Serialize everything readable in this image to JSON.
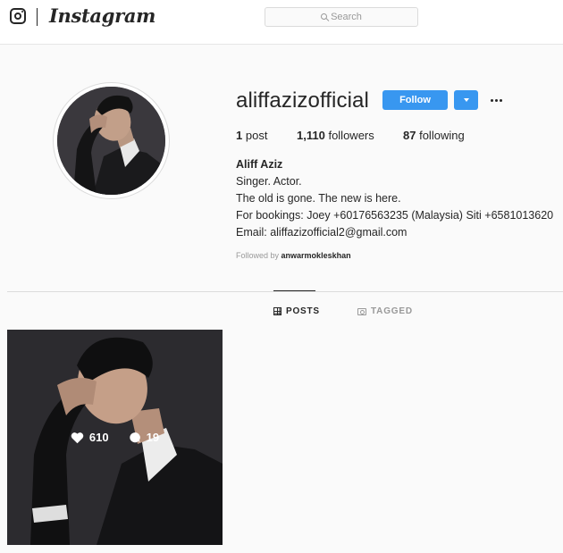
{
  "nav": {
    "logo_icon": "instagram-glyph-icon",
    "wordmark": "Instagram",
    "search_placeholder": "Search",
    "search_icon": "search-icon"
  },
  "profile": {
    "username": "aliffazizofficial",
    "follow_label": "Follow",
    "dropdown_icon": "chevron-down-icon",
    "more_icon": "more-options-icon",
    "stats": {
      "posts_count": "1",
      "posts_label": "post",
      "followers_count": "1,110",
      "followers_label": "followers",
      "following_count": "87",
      "following_label": "following"
    },
    "bio": {
      "name": "Aliff Aziz",
      "lines": [
        "Singer. Actor.",
        "The old is gone. The new is here.",
        "For bookings: Joey +60176563235 (Malaysia) Siti +6581013620",
        "Email: aliffazizofficial2@gmail.com"
      ]
    },
    "followed_by_prefix": "Followed by",
    "followed_by_user": "anwarmokleskhan"
  },
  "tabs": [
    {
      "label": "POSTS",
      "icon": "grid-icon",
      "active": true
    },
    {
      "label": "TAGGED",
      "icon": "tagged-icon",
      "active": false
    }
  ],
  "posts": [
    {
      "likes": "610",
      "comments": "19",
      "like_icon": "heart-icon",
      "comment_icon": "comment-bubble-icon"
    }
  ],
  "colors": {
    "accent": "#3897f0",
    "background": "#fafafa",
    "text": "#262626",
    "muted": "#999999"
  }
}
